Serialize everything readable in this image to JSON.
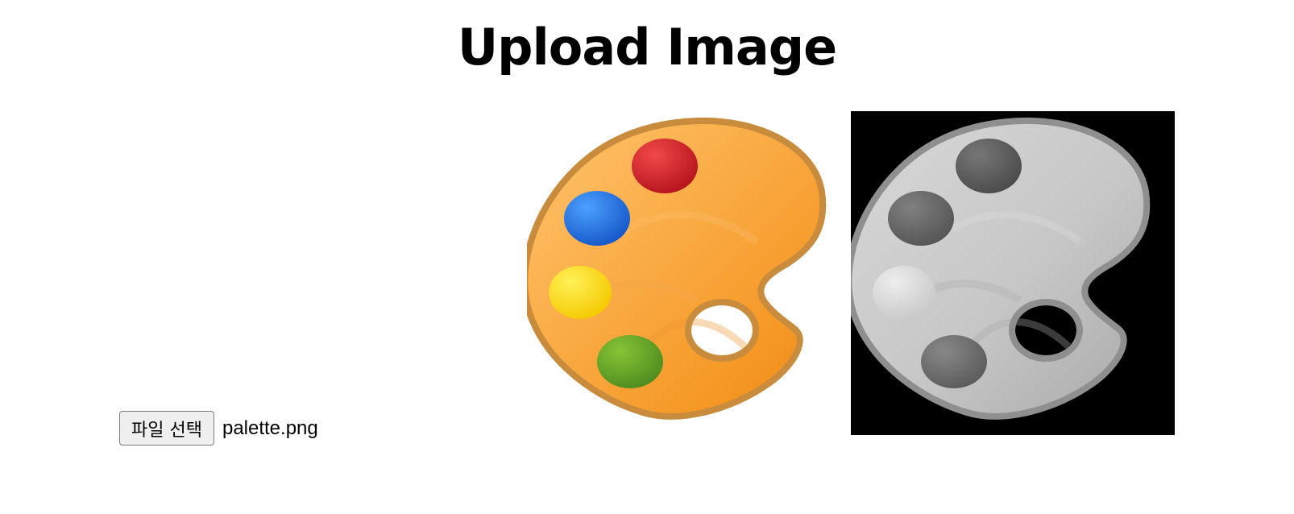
{
  "page": {
    "title": "Upload Image"
  },
  "uploader": {
    "button_label": "파일 선택",
    "file_name": "palette.png"
  },
  "images": {
    "original_icon": "palette-icon",
    "grayscale_icon": "grayscale-palette-icon"
  },
  "colors": {
    "palette_orange": "#f8a53a",
    "paint_red": "#d9232f",
    "paint_blue": "#2878e6",
    "paint_yellow": "#ffe21a",
    "paint_green": "#6ba92a",
    "grayscale_background": "#000000"
  }
}
